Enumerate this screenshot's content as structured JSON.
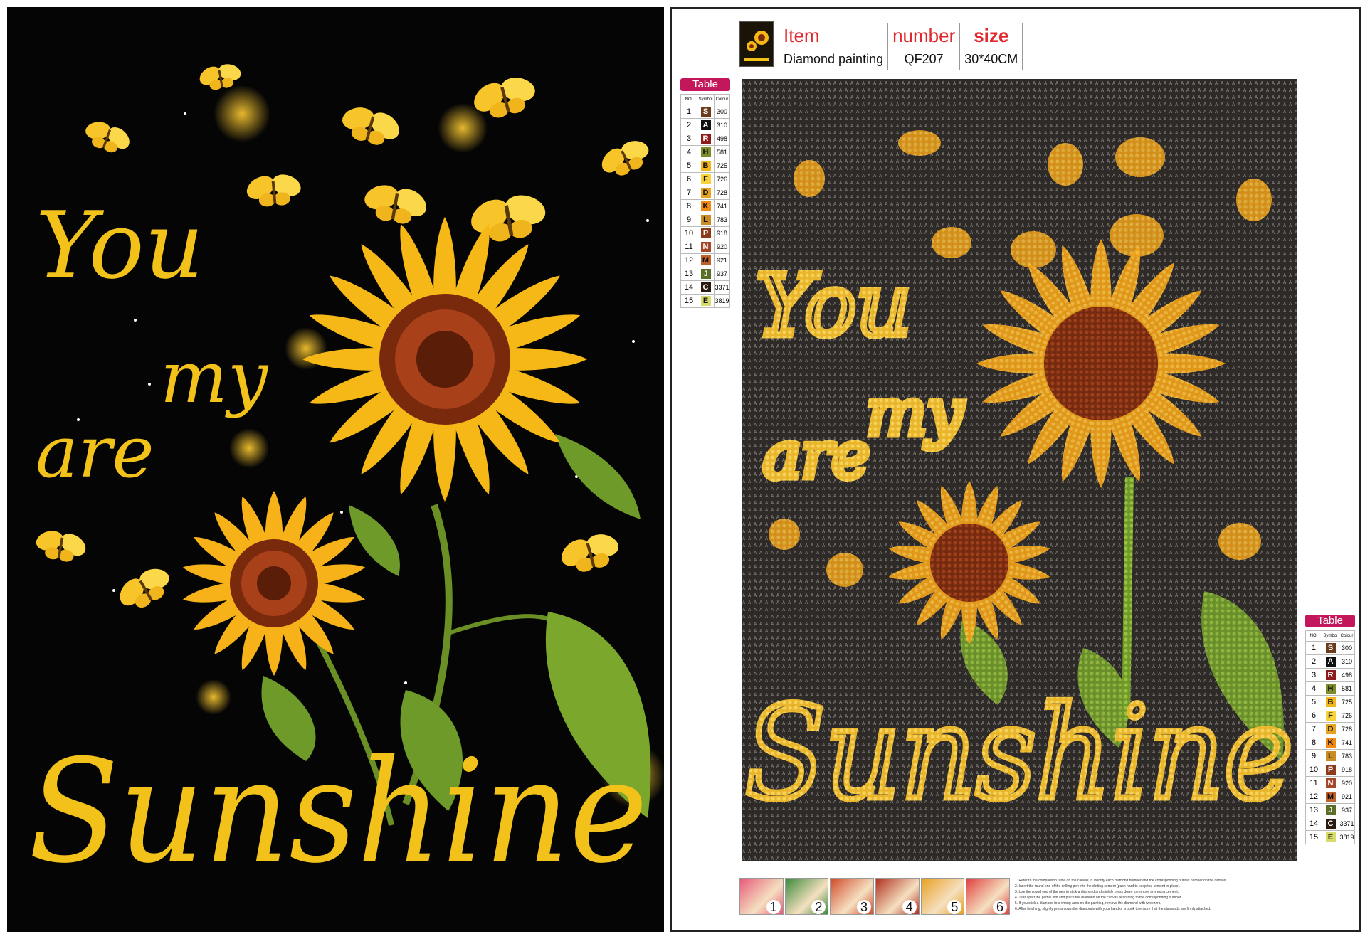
{
  "left_artwork": {
    "lines": [
      "You",
      "my",
      "are",
      "Sunshine"
    ],
    "colors": {
      "background": "#050505",
      "text": "#f2c21b",
      "petal": "#f6b816",
      "center": "#7a2a0c",
      "leaf": "#6e9a2a"
    }
  },
  "product_info": {
    "headers": [
      "Item",
      "number",
      "size"
    ],
    "values": [
      "Diamond painting",
      "QF207",
      "30*40CM"
    ],
    "header_color": "#e0292e"
  },
  "legend": {
    "title": "Table",
    "columns": [
      "NO.",
      "Symbol",
      "Colour"
    ],
    "rows": [
      {
        "no": "1",
        "symbol": "S",
        "colour": "300",
        "hex": "#6b3b1b"
      },
      {
        "no": "2",
        "symbol": "A",
        "colour": "310",
        "hex": "#111111"
      },
      {
        "no": "3",
        "symbol": "R",
        "colour": "498",
        "hex": "#8e1b1b"
      },
      {
        "no": "4",
        "symbol": "H",
        "colour": "581",
        "hex": "#7f8a2a"
      },
      {
        "no": "5",
        "symbol": "B",
        "colour": "725",
        "hex": "#f3b41c"
      },
      {
        "no": "6",
        "symbol": "F",
        "colour": "726",
        "hex": "#f8d23a"
      },
      {
        "no": "7",
        "symbol": "D",
        "colour": "728",
        "hex": "#e6a321"
      },
      {
        "no": "8",
        "symbol": "K",
        "colour": "741",
        "hex": "#f08a13"
      },
      {
        "no": "9",
        "symbol": "L",
        "colour": "783",
        "hex": "#c98d25"
      },
      {
        "no": "10",
        "symbol": "P",
        "colour": "918",
        "hex": "#8b3a1a"
      },
      {
        "no": "11",
        "symbol": "N",
        "colour": "920",
        "hex": "#a5472a"
      },
      {
        "no": "12",
        "symbol": "M",
        "colour": "921",
        "hex": "#c0602b"
      },
      {
        "no": "13",
        "symbol": "J",
        "colour": "937",
        "hex": "#5a6e25"
      },
      {
        "no": "14",
        "symbol": "C",
        "colour": "3371",
        "hex": "#2b1a10"
      },
      {
        "no": "15",
        "symbol": "E",
        "colour": "3819",
        "hex": "#d8dc6a"
      }
    ]
  },
  "pattern_canvas": {
    "lines": [
      "You",
      "my",
      "are",
      "Sunshine"
    ],
    "background_symbol": "A",
    "colors": {
      "background": "#2e2a27",
      "symbol": "#8f8a86",
      "bead": "#e9b52b"
    }
  },
  "steps": {
    "numbers": [
      "1",
      "2",
      "3",
      "4",
      "5",
      "6"
    ],
    "colors": [
      "#e85a7a",
      "#3a8a3a",
      "#d04a2a",
      "#b03020",
      "#e8a020",
      "#e04040"
    ]
  },
  "instructions": [
    "1. Refer to the comparison table on the canvas to identify each diamond number and the corresponding printed number on the canvas.",
    "2. Insert the round end of the drilling pen into the dotting cement (push hard to keep the cement in place).",
    "3. Use the round end of the pen to stick a diamond and slightly press down to remove any extra cement.",
    "4. Tear apart the partial film and place the diamond on the canvas according to the corresponding number.",
    "5. If you stick a diamond to a wrong area on the painting, remove the diamond with tweezers.",
    "6. After finishing, slightly press down the diamonds with your hand or a book to ensure that the diamonds are firmly attached."
  ]
}
